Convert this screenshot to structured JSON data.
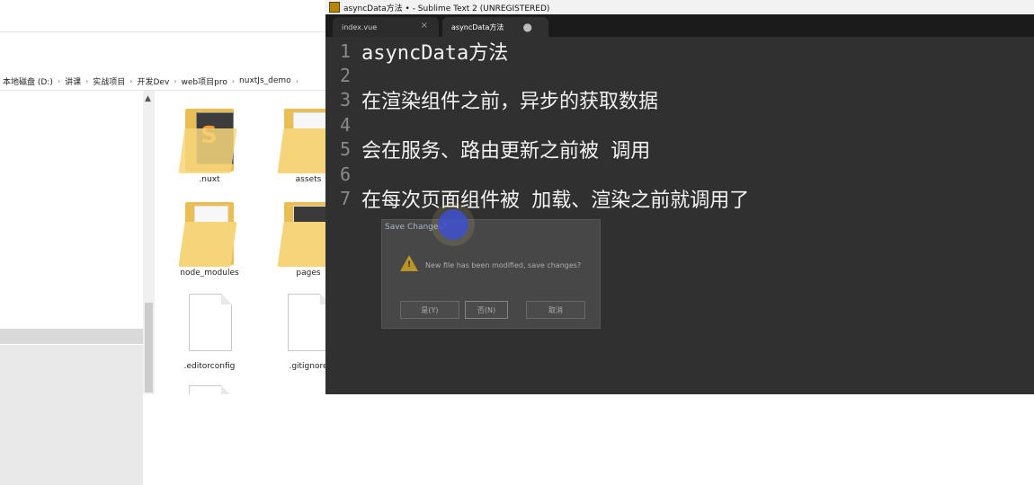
{
  "explorer": {
    "breadcrumb": [
      "本地磁盘 (D:)",
      "讲课",
      "实战项目",
      "开发Dev",
      "web项目pro",
      "nuxtJs_demo"
    ],
    "breadcrumb_separator": "›",
    "files": [
      {
        "name": ".nuxt",
        "icon": "sublime-folder-icon"
      },
      {
        "name": "assets",
        "icon": "folder-icon"
      },
      {
        "name": "node_modules",
        "icon": "folder-icon"
      },
      {
        "name": "pages",
        "icon": "folder-icon"
      },
      {
        "name": ".editorconfig",
        "icon": "file-icon"
      },
      {
        "name": ".gitignore",
        "icon": "file-icon"
      }
    ]
  },
  "sublime": {
    "window_title": "asyncData方法 • - Sublime Text 2 (UNREGISTERED)",
    "tabs": [
      {
        "label": "index.vue",
        "close": "×"
      },
      {
        "label": "asyncData方法",
        "modified": "●"
      }
    ],
    "lines": [
      {
        "num": "1",
        "text": "asyncData方法"
      },
      {
        "num": "2",
        "text": ""
      },
      {
        "num": "3",
        "text": "在渲染组件之前，异步的获取数据"
      },
      {
        "num": "4",
        "text": ""
      },
      {
        "num": "5",
        "text": "会在服务、路由更新之前被 调用"
      },
      {
        "num": "6",
        "text": ""
      },
      {
        "num": "7",
        "text": "在每次页面组件被 加载、渲染之前就调用了"
      }
    ]
  },
  "dialog": {
    "title": "Save Changes?",
    "message": "New file has been modified, save changes?",
    "buttons": {
      "yes": "是(Y)",
      "no": "否(N)",
      "cancel": "取消"
    }
  },
  "colors": {
    "editor_bg": "#303030",
    "tabbar_bg": "#1b1b1b",
    "folder": "#f6d57a",
    "cursor_highlight": "#3d4fd0"
  }
}
